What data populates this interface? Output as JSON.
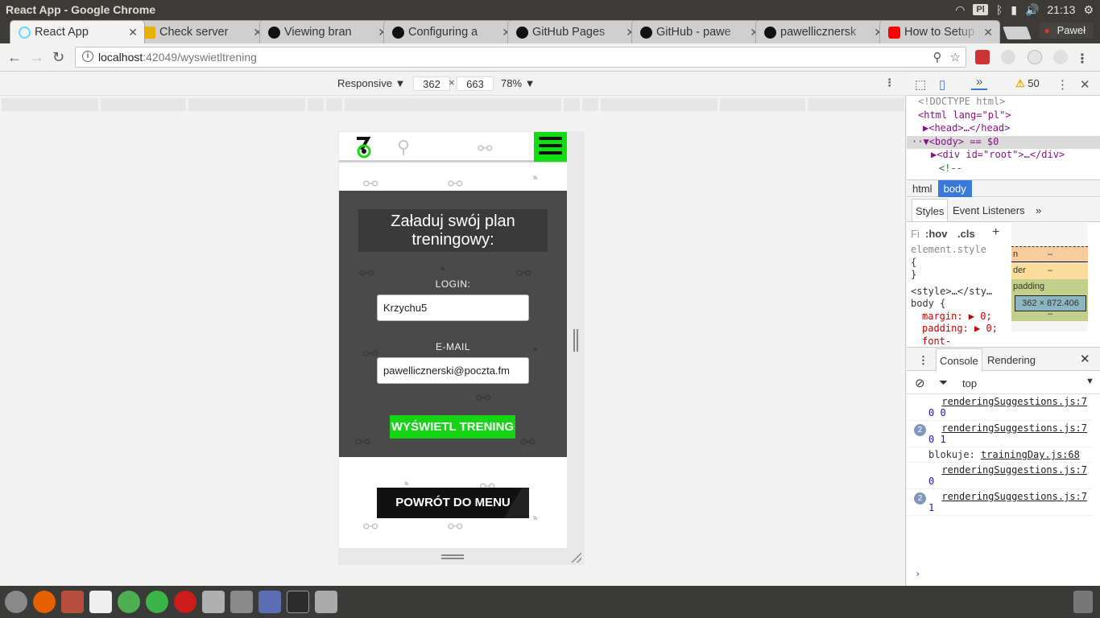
{
  "system": {
    "window_title": "React App - Google Chrome",
    "keyboard": "Pl",
    "time": "21:13",
    "user": "Paweł"
  },
  "tabs": [
    {
      "label": "React App",
      "icon_color": "#61dafb",
      "active": true
    },
    {
      "label": "Check server",
      "icon_color": "#e8b000"
    },
    {
      "label": "Viewing bran",
      "icon_color": "#111111"
    },
    {
      "label": "Configuring a",
      "icon_color": "#111111"
    },
    {
      "label": "GitHub Pages",
      "icon_color": "#111111"
    },
    {
      "label": "GitHub - pawe",
      "icon_color": "#111111"
    },
    {
      "label": "pawellicznersk",
      "icon_color": "#111111"
    },
    {
      "label": "How to Setup",
      "icon_color": "#ff0000"
    }
  ],
  "address": {
    "host": "localhost",
    "path": ":42049/wyswietltrening"
  },
  "device": {
    "mode": "Responsive",
    "width": "362",
    "height": "663",
    "zoom": "78%"
  },
  "app": {
    "title": "Załaduj swój plan treningowy:",
    "login_label": "LOGIN:",
    "login_value": "Krzychu5",
    "email_label": "E-MAIL",
    "email_value": "pawellicznerski@poczta.fm",
    "show_button": "WYŚWIETL TRENING",
    "back_button": "POWRÓT DO MENU",
    "accent": "#14d414"
  },
  "devtools": {
    "warnings": "50",
    "tree": [
      "<!DOCTYPE html>",
      "<html lang=\"pl\">",
      "<head>…</head>",
      "<body> == $0",
      "<div id=\"root\">…</div>",
      "<!--"
    ],
    "crumb_html": "html",
    "crumb_body": "body",
    "tab_styles": "Styles",
    "tab_listeners": "Event Listeners",
    "filter": "Fi",
    "hov": ":hov",
    "cls": ".cls",
    "rules": [
      "element.style",
      "{",
      "}",
      "<style>…</sty…",
      "body {",
      "margin: ▶ 0;",
      "padding: ▶ 0;",
      "font-"
    ],
    "box_margin": "n",
    "box_border": "der",
    "box_padding": "padding",
    "dash": "–",
    "box_size": "362 × 872.406",
    "console_tab": "Console",
    "rendering_tab": "Rendering",
    "context": "top",
    "logs": [
      {
        "src": "renderingSuggestions.js:7",
        "text": "0 0",
        "count": ""
      },
      {
        "src": "renderingSuggestions.js:7",
        "text": "0 1",
        "count": "2"
      },
      {
        "src": "trainingDay.js:68",
        "text": "blokuje:",
        "count": ""
      },
      {
        "src": "renderingSuggestions.js:7",
        "text": "0",
        "count": ""
      },
      {
        "src": "renderingSuggestions.js:7",
        "text": "1",
        "count": "2"
      }
    ]
  }
}
